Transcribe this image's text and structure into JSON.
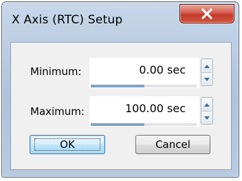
{
  "window": {
    "title": "X Axis (RTC) Setup",
    "close_icon": "close-icon"
  },
  "fields": {
    "minimum": {
      "label": "Minimum:",
      "value": "0.00 sec"
    },
    "maximum": {
      "label": "Maximum:",
      "value": "100.00 sec"
    }
  },
  "buttons": {
    "ok_label": "OK",
    "cancel_label": "Cancel"
  },
  "colors": {
    "close_button": "#c23a2b",
    "frame": "#aec3dc",
    "dialog_background": "#f0f0f0"
  }
}
